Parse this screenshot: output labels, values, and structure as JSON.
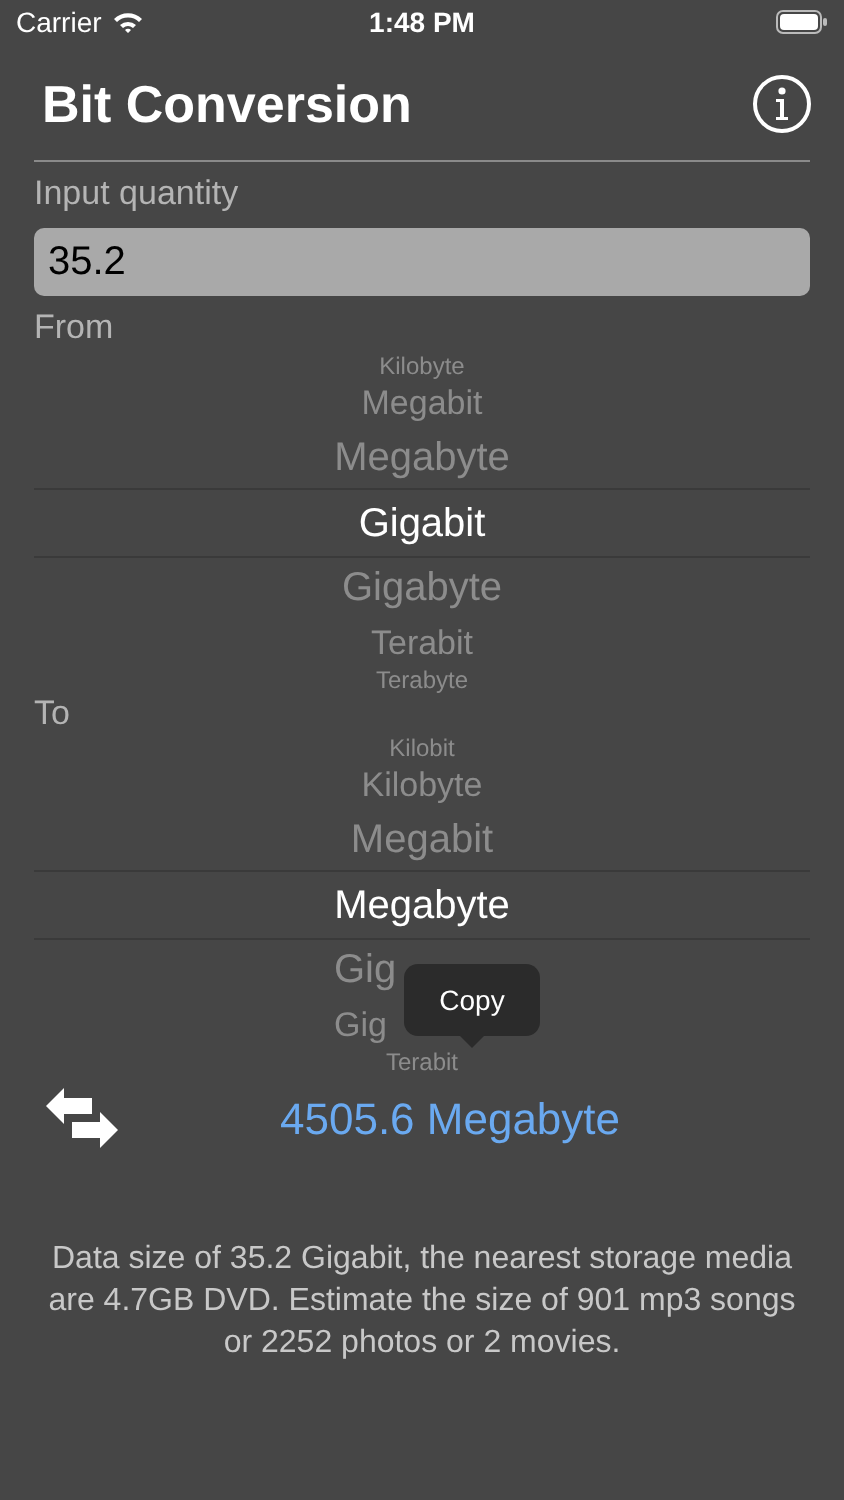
{
  "status_bar": {
    "carrier": "Carrier",
    "time": "1:48 PM"
  },
  "title": "Bit Conversion",
  "input": {
    "label": "Input quantity",
    "value": "35.2"
  },
  "from": {
    "label": "From",
    "items": [
      {
        "label": "Kilobyte",
        "selected": false
      },
      {
        "label": "Megabit",
        "selected": false
      },
      {
        "label": "Megabyte",
        "selected": false
      },
      {
        "label": "Gigabit",
        "selected": true
      },
      {
        "label": "Gigabyte",
        "selected": false
      },
      {
        "label": "Terabit",
        "selected": false
      },
      {
        "label": "Terabyte",
        "selected": false
      }
    ]
  },
  "to": {
    "label": "To",
    "items": [
      {
        "label": "Kilobit",
        "selected": false
      },
      {
        "label": "Kilobyte",
        "selected": false
      },
      {
        "label": "Megabit",
        "selected": false
      },
      {
        "label": "Megabyte",
        "selected": true
      },
      {
        "label": "Gig",
        "selected": false,
        "kind": "clipped"
      },
      {
        "label": "Gig",
        "selected": false,
        "kind": "clipped"
      },
      {
        "label": "Terabit",
        "selected": false
      }
    ]
  },
  "tooltip": "Copy",
  "result": "4505.6 Megabyte",
  "description": "Data size of 35.2 Gigabit, the nearest storage media are 4.7GB DVD. Estimate the size of 901 mp3 songs or 2252 photos or 2 movies."
}
